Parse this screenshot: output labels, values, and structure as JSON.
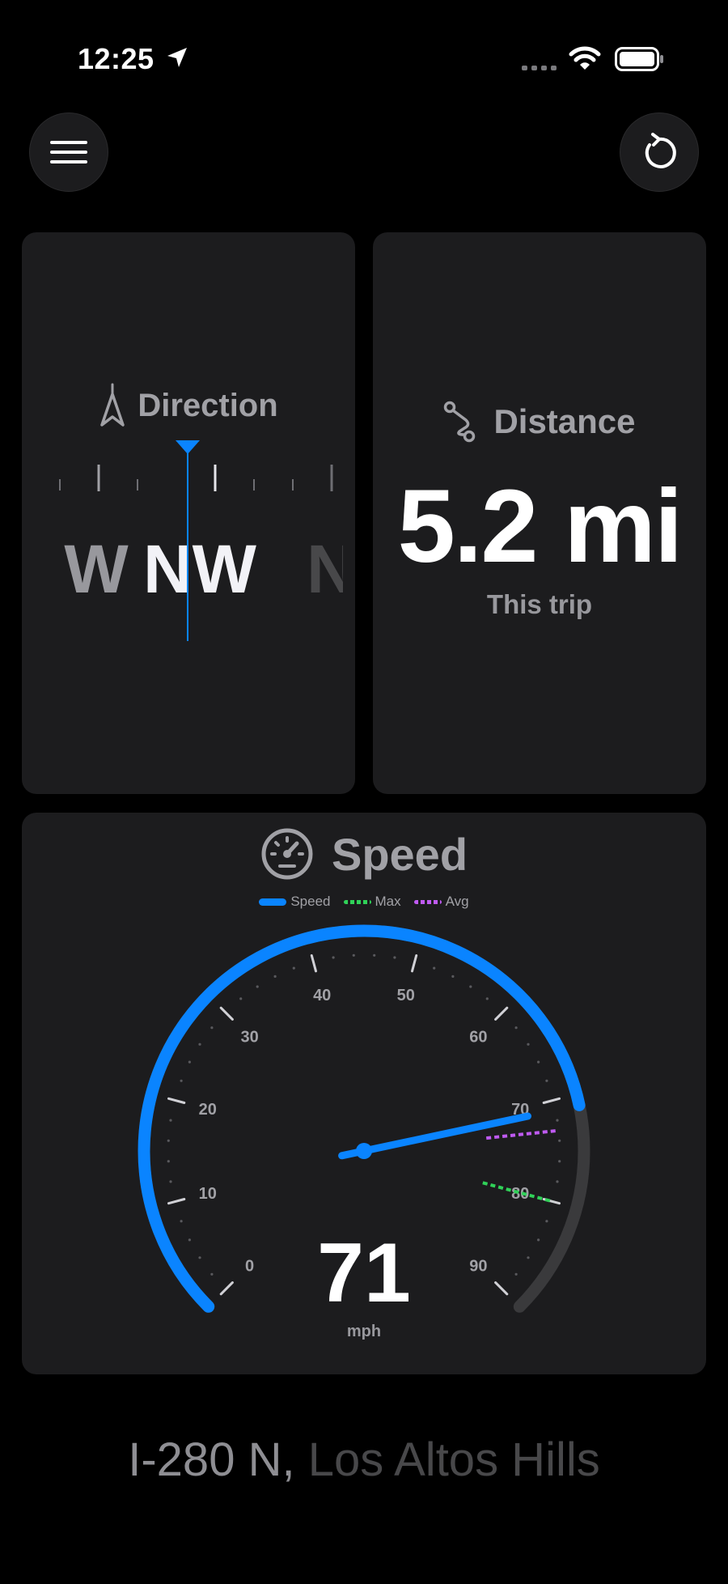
{
  "status_bar": {
    "time": "12:25",
    "icons": [
      "location-arrow-icon",
      "cellular-signal-icon",
      "wifi-icon",
      "battery-icon"
    ]
  },
  "toolbar": {
    "menu_icon": "hamburger-menu-icon",
    "reset_icon": "reset-trip-icon"
  },
  "direction": {
    "title": "Direction",
    "icon": "compass-arrow-icon",
    "labels": [
      "W",
      "NW",
      "N"
    ],
    "current": "NW",
    "heading_pointer_color": "#0a84ff"
  },
  "distance": {
    "title": "Distance",
    "icon": "route-icon",
    "value": "5.2 mi",
    "caption": "This trip"
  },
  "speed": {
    "title": "Speed",
    "icon": "speedometer-icon",
    "legend": {
      "speed": "Speed",
      "max": "Max",
      "avg": "Avg"
    },
    "value": "71",
    "unit": "mph",
    "colors": {
      "speed": "#0a84ff",
      "max": "#30d158",
      "avg": "#bf5af2",
      "track": "#3a3a3c"
    }
  },
  "chart_data": {
    "type": "gauge",
    "min": 0,
    "max": 90,
    "tick_labels": [
      "0",
      "10",
      "20",
      "30",
      "40",
      "50",
      "60",
      "70",
      "80",
      "90"
    ],
    "current": 71,
    "max_speed": 80,
    "avg_speed": 73,
    "unit": "mph"
  },
  "location": {
    "road": "I-280 N",
    "separator": ",",
    "place": " Los Altos Hills"
  }
}
